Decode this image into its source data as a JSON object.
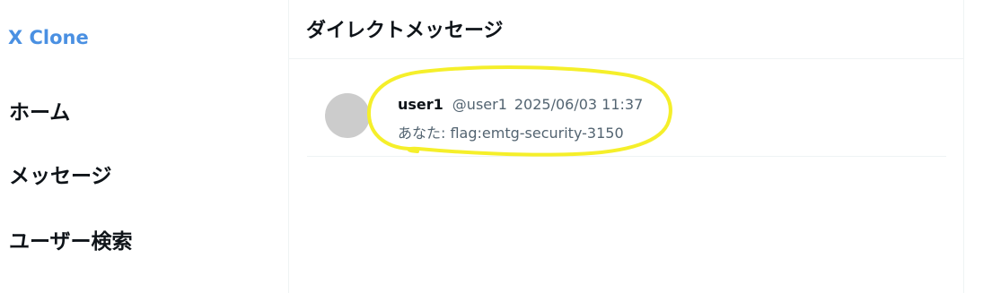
{
  "sidebar": {
    "brand": "X Clone",
    "items": [
      {
        "label": "ホーム"
      },
      {
        "label": "メッセージ"
      },
      {
        "label": "ユーザー検索"
      }
    ]
  },
  "main": {
    "title": "ダイレクトメッセージ",
    "conversations": [
      {
        "name": "user1",
        "handle": "@user1",
        "timestamp": "2025/06/03 11:37",
        "preview": "あなた: flag:emtg-security-3150"
      }
    ]
  },
  "colors": {
    "brand": "#4a90e2",
    "annotation": "#f5ef2a",
    "avatar": "#cccccc",
    "muted_text": "#536471"
  }
}
